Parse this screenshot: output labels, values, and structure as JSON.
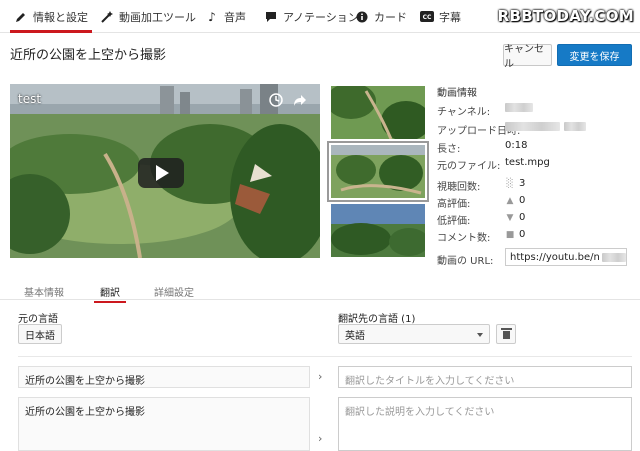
{
  "nav": {
    "tabs": [
      {
        "label": "情報と設定",
        "icon": "pencil-icon",
        "active": true
      },
      {
        "label": "動画加工ツール",
        "icon": "magic-wand-icon",
        "active": false
      },
      {
        "label": "音声",
        "icon": "music-note-icon",
        "active": false
      },
      {
        "label": "アノテーション",
        "icon": "speech-bubble-icon",
        "active": false
      },
      {
        "label": "カード",
        "icon": "info-circle-icon",
        "active": false
      },
      {
        "label": "字幕",
        "icon": "cc-icon",
        "active": false
      }
    ],
    "watermark": "RBBTODAY.COM"
  },
  "header": {
    "title": "近所の公園を上空から撮影",
    "cancel_label": "キャンセル",
    "save_label": "変更を保存"
  },
  "video": {
    "title": "test",
    "icons": [
      "clock-icon",
      "share-icon",
      "play-icon"
    ]
  },
  "info": {
    "heading": "動画情報",
    "channel_label": "チャンネル:",
    "upload_label": "アップロード日時:",
    "duration_label": "長さ:",
    "duration": "0:18",
    "file_label": "元のファイル:",
    "file": "test.mpg",
    "views_label": "視聴回数:",
    "views": "3",
    "likes_label": "高評価:",
    "likes": "0",
    "dislikes_label": "低評価:",
    "dislikes": "0",
    "comments_label": "コメント数:",
    "comments": "0",
    "url_label": "動画の URL:",
    "url": "https://youtu.be/n"
  },
  "subtabs": [
    "基本情報",
    "翻訳",
    "詳細設定"
  ],
  "translation": {
    "source_label": "元の言語",
    "source_lang": "日本語",
    "target_label": "翻訳先の言語 (1)",
    "target_lang": "英語",
    "source_title": "近所の公園を上空から撮影",
    "source_desc": "近所の公園を上空から撮影",
    "title_placeholder": "翻訳したタイトルを入力してください",
    "desc_placeholder": "翻訳した説明を入力してください"
  },
  "colors": {
    "accent": "#cc181e",
    "primary_button": "#167ac6"
  }
}
